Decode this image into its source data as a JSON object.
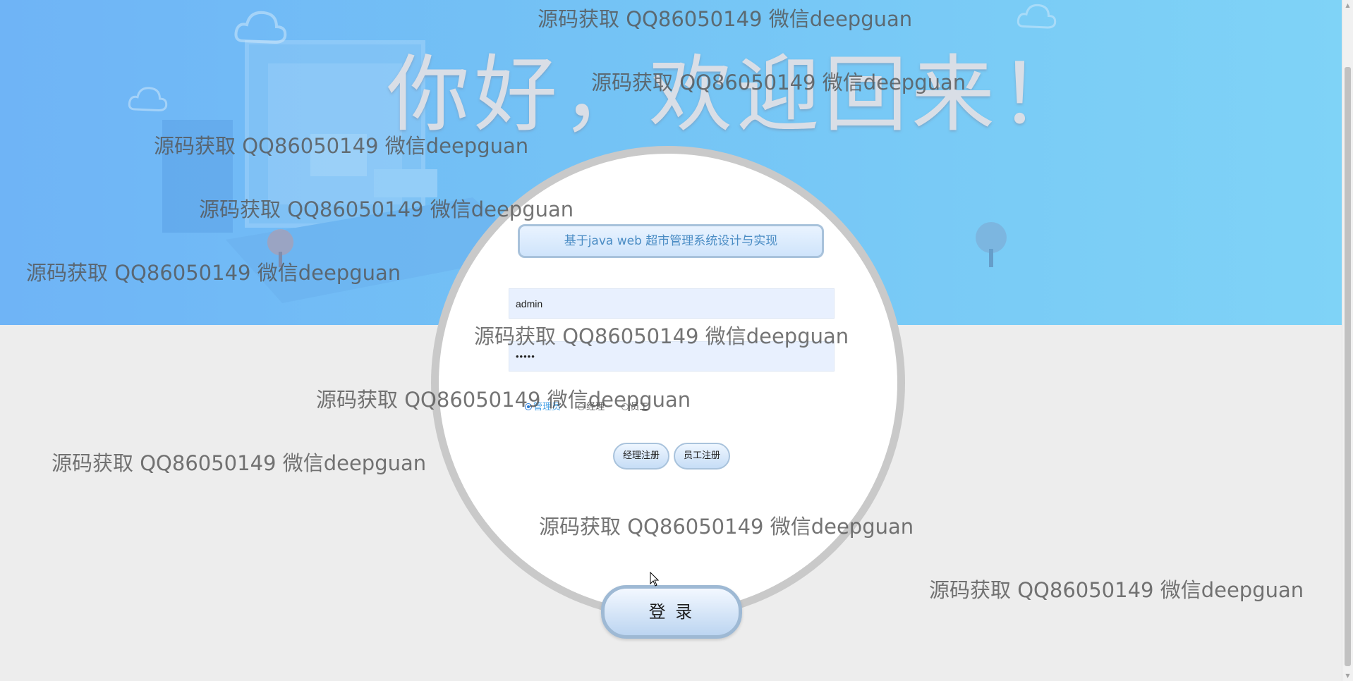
{
  "welcome_heading": "你好，欢迎回来！",
  "system_title": "基于java web 超市管理系统设计与实现",
  "login_form": {
    "username_value": "admin",
    "password_value": "•••••",
    "roles": [
      {
        "label": "管理员",
        "checked": true
      },
      {
        "label": "经理",
        "checked": false
      },
      {
        "label": "员工",
        "checked": false
      }
    ],
    "manager_register_label": "经理注册",
    "employee_register_label": "员工注册",
    "login_label": "登 录"
  },
  "watermark_text": "源码获取 QQ86050149 微信deepguan",
  "colors": {
    "banner_start": "#6fb4f6",
    "banner_end": "#7fd3f7",
    "page_background": "#ededed",
    "circle_border": "#c9c9c9",
    "title_text": "#4a8cc4"
  }
}
